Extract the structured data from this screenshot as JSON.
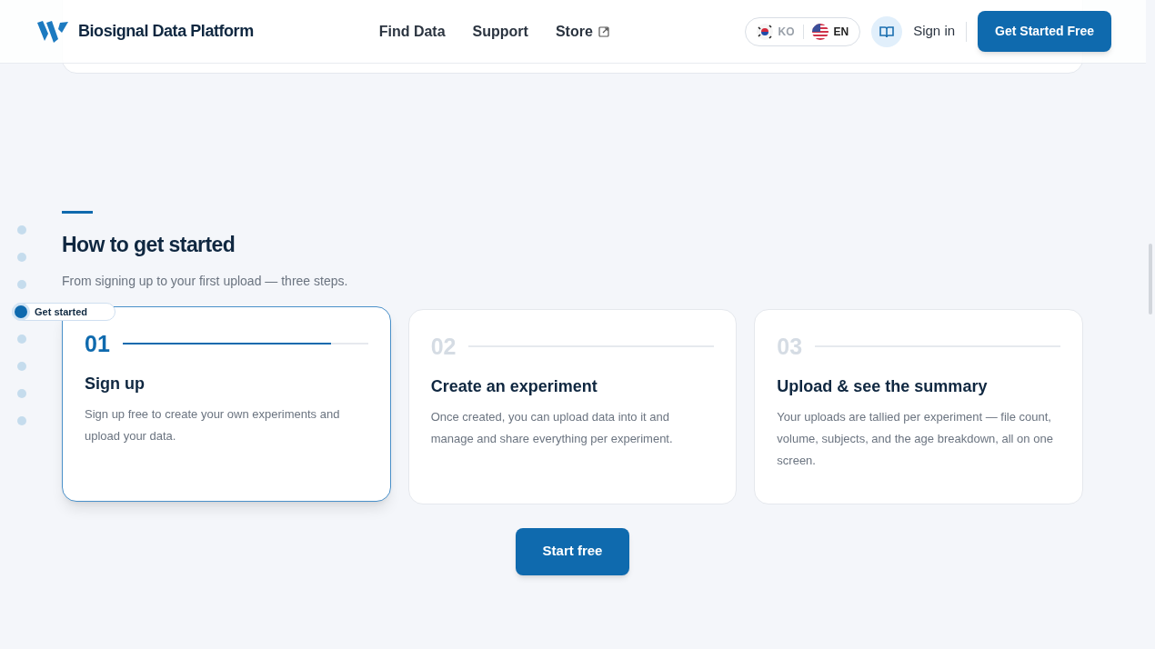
{
  "header": {
    "brand": "Biosignal Data Platform",
    "nav": [
      {
        "label": "Find Data",
        "external": false
      },
      {
        "label": "Support",
        "external": false
      },
      {
        "label": "Store",
        "external": true
      }
    ],
    "languages": [
      {
        "code": "KO",
        "kind": "kr",
        "selected": false
      },
      {
        "code": "EN",
        "kind": "us",
        "selected": true
      }
    ],
    "sign_in": "Sign in",
    "cta": "Get Started Free"
  },
  "side_nav": [
    {
      "selected": false
    },
    {
      "selected": false
    },
    {
      "selected": false
    },
    {
      "label": "Get started",
      "selected": true
    },
    {
      "selected": false
    },
    {
      "selected": false
    },
    {
      "selected": false
    },
    {
      "selected": false
    }
  ],
  "section": {
    "title": "How to get started",
    "subtitle": "From signing up to your first upload — three steps.",
    "steps": [
      {
        "number": "01",
        "title": "Sign up",
        "text": "Sign up free to create your own experiments and upload your data.",
        "selected": true,
        "level": 0.85
      },
      {
        "number": "02",
        "title": "Create an experiment",
        "text": "Once created, you can upload data into it and manage and share everything per experiment.",
        "selected": false
      },
      {
        "number": "03",
        "title": "Upload & see the summary",
        "text": "Your uploads are tallied per experiment — file count, volume, subjects, and the age breakdown, all on one screen.",
        "selected": false
      }
    ],
    "button": "Start free"
  }
}
